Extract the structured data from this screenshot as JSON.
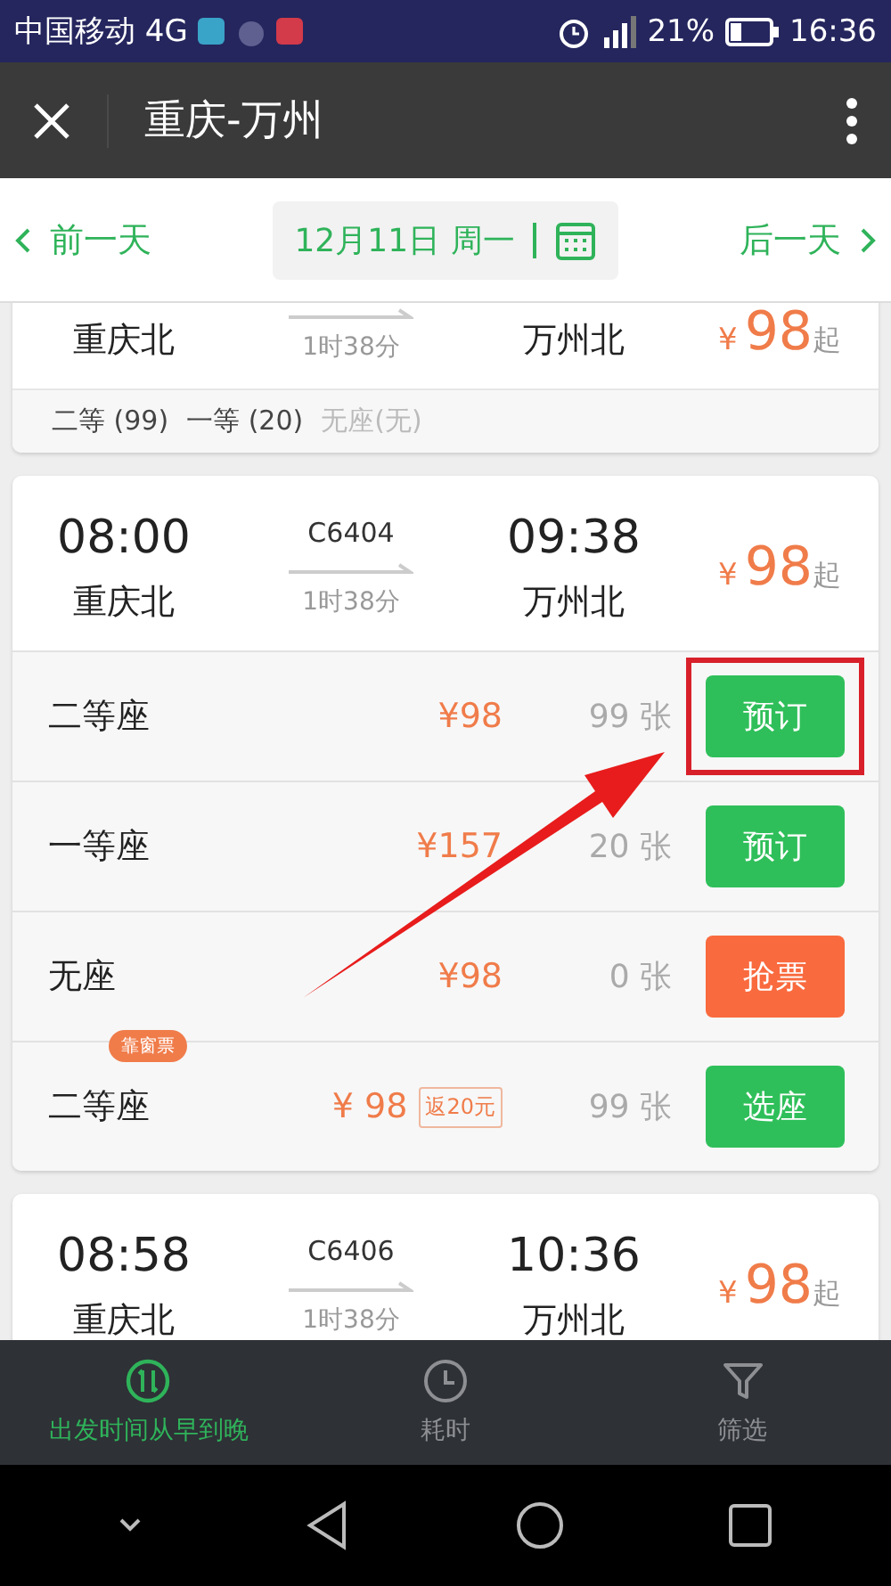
{
  "status_bar": {
    "carrier": "中国移动 4G",
    "battery": "21%",
    "time": "16:36"
  },
  "header": {
    "title": "重庆-万州"
  },
  "date_nav": {
    "prev": "前一天",
    "date": "12月11日 周一",
    "next": "后一天"
  },
  "trains": [
    {
      "from": "重庆北",
      "duration": "1时38分",
      "to": "万州北",
      "currency": "¥",
      "price": "98",
      "price_suffix": "起",
      "summary": [
        {
          "label": "二等 (99)",
          "available": true
        },
        {
          "label": "一等 (20)",
          "available": true
        },
        {
          "label": "无座(无)",
          "available": false
        }
      ]
    },
    {
      "depart": "08:00",
      "train": "C6404",
      "arrive": "09:38",
      "from": "重庆北",
      "duration": "1时38分",
      "to": "万州北",
      "currency": "¥",
      "price": "98",
      "price_suffix": "起",
      "seats": [
        {
          "name": "二等座",
          "price": "¥98",
          "count": "99 张",
          "action": "预订",
          "kind": "book",
          "highlighted": true
        },
        {
          "name": "一等座",
          "price": "¥157",
          "count": "20 张",
          "action": "预订",
          "kind": "book",
          "highlighted": false
        },
        {
          "name": "无座",
          "price": "¥98",
          "count": "0 张",
          "action": "抢票",
          "kind": "grab",
          "highlighted": false
        },
        {
          "name": "二等座",
          "badge": "靠窗票",
          "price": "¥ 98",
          "rebate": "返20元",
          "count": "99 张",
          "action": "选座",
          "kind": "book",
          "highlighted": false
        }
      ]
    },
    {
      "depart": "08:58",
      "train": "C6406",
      "arrive": "10:36",
      "from": "重庆北",
      "duration": "1时38分",
      "to": "万州北",
      "currency": "¥",
      "price": "98",
      "price_suffix": "起"
    }
  ],
  "tabs": [
    {
      "label": "出发时间从早到晚",
      "kind": "sort",
      "selected": true
    },
    {
      "label": "耗时",
      "kind": "duration",
      "selected": false
    },
    {
      "label": "筛选",
      "kind": "filter",
      "selected": false
    }
  ]
}
